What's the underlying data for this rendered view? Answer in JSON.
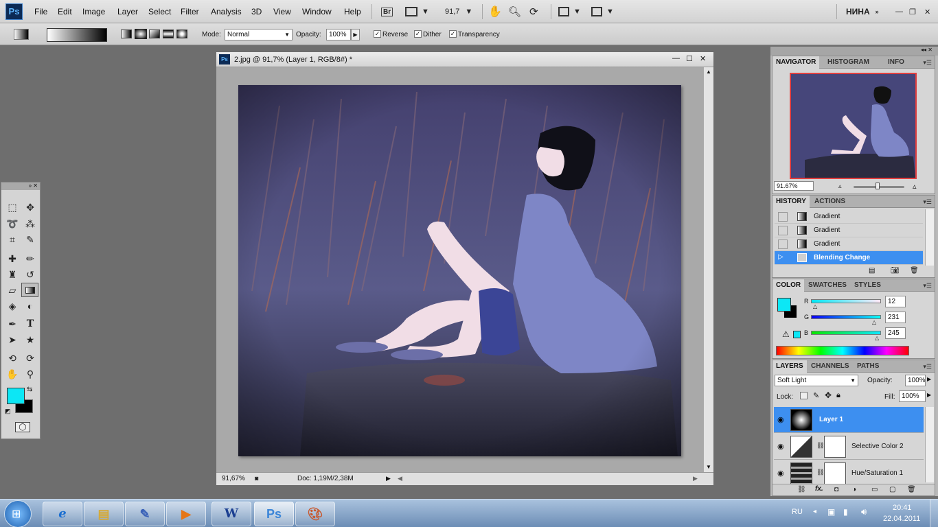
{
  "menubar": {
    "logo": "Ps",
    "items": [
      "File",
      "Edit",
      "Image",
      "Layer",
      "Select",
      "Filter",
      "Analysis",
      "3D",
      "View",
      "Window",
      "Help"
    ],
    "bridge": "Br",
    "zoom": "91,7",
    "workspace": "НИНА"
  },
  "options": {
    "mode_label": "Mode:",
    "mode_value": "Normal",
    "opacity_label": "Opacity:",
    "opacity_value": "100%",
    "reverse": "Reverse",
    "dither": "Dither",
    "transparency": "Transparency"
  },
  "document": {
    "title": "2.jpg @ 91,7% (Layer 1, RGB/8#) *",
    "zoom": "91,67%",
    "doc_info": "Doc: 1,19M/2,38M"
  },
  "navigator": {
    "tabs": [
      "NAVIGATOR",
      "HISTOGRAM",
      "INFO"
    ],
    "zoom": "91.67%"
  },
  "history": {
    "tabs": [
      "HISTORY",
      "ACTIONS"
    ],
    "items": [
      "Gradient",
      "Gradient",
      "Gradient",
      "Blending Change"
    ]
  },
  "color": {
    "tabs": [
      "COLOR",
      "SWATCHES",
      "STYLES"
    ],
    "r_label": "R",
    "g_label": "G",
    "b_label": "B",
    "r": "12",
    "g": "231",
    "b": "245",
    "foreground": "#0ce7f5",
    "background": "#000000"
  },
  "layers": {
    "tabs": [
      "LAYERS",
      "CHANNELS",
      "PATHS"
    ],
    "blend_mode": "Soft Light",
    "opacity_label": "Opacity:",
    "opacity": "100%",
    "lock_label": "Lock:",
    "fill_label": "Fill:",
    "fill": "100%",
    "items": [
      "Layer 1",
      "Selective Color 2",
      "Hue/Saturation 1"
    ]
  },
  "taskbar": {
    "lang": "RU",
    "time": "20:41",
    "date": "22.04.2011"
  }
}
